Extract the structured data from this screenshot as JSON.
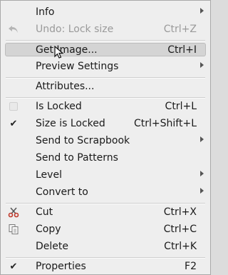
{
  "menu": {
    "items": [
      {
        "label": "Info",
        "submenu": true
      },
      {
        "label": "Undo: Lock size",
        "shortcut": "Ctrl+Z",
        "disabled": true,
        "icon": "undo-icon"
      },
      {
        "label": "Get Image...",
        "shortcut": "Ctrl+I",
        "highlighted": true
      },
      {
        "label": "Preview Settings",
        "submenu": true
      },
      {
        "label": "Attributes..."
      },
      {
        "label": "Is Locked",
        "shortcut": "Ctrl+L",
        "checkbox": "unchecked"
      },
      {
        "label": "Size is Locked",
        "shortcut": "Ctrl+Shift+L",
        "checkbox": "checked"
      },
      {
        "label": "Send to Scrapbook",
        "submenu": true
      },
      {
        "label": "Send to Patterns"
      },
      {
        "label": "Level",
        "submenu": true
      },
      {
        "label": "Convert to",
        "submenu": true
      },
      {
        "label": "Cut",
        "shortcut": "Ctrl+X",
        "icon": "scissors-icon"
      },
      {
        "label": "Copy",
        "shortcut": "Ctrl+C",
        "icon": "copy-icon"
      },
      {
        "label": "Delete",
        "shortcut": "Ctrl+K"
      },
      {
        "label": "Properties",
        "shortcut": "F2",
        "checkbox": "checked"
      }
    ]
  },
  "colors": {
    "menu_background": "#eeeeee",
    "highlight": "#d4d4d4",
    "disabled_text": "#9a9a9a",
    "cut_icon": "#c0392b"
  }
}
